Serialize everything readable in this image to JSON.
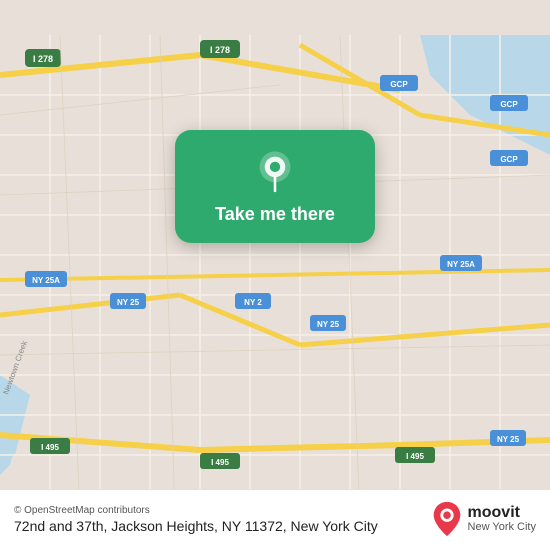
{
  "map": {
    "bg_color": "#e8e0d8",
    "water_color": "#acd3e8",
    "road_yellow": "#f5d048",
    "road_light": "#f0ead8"
  },
  "card": {
    "label": "Take me there",
    "bg_color": "#2eaa6e",
    "pin_icon": "location-pin"
  },
  "bottom": {
    "osm_credit": "© OpenStreetMap contributors",
    "address": "72nd and 37th, Jackson Heights, NY 11372, New York City",
    "moovit_label": "moovit",
    "moovit_sub": "New York City"
  }
}
